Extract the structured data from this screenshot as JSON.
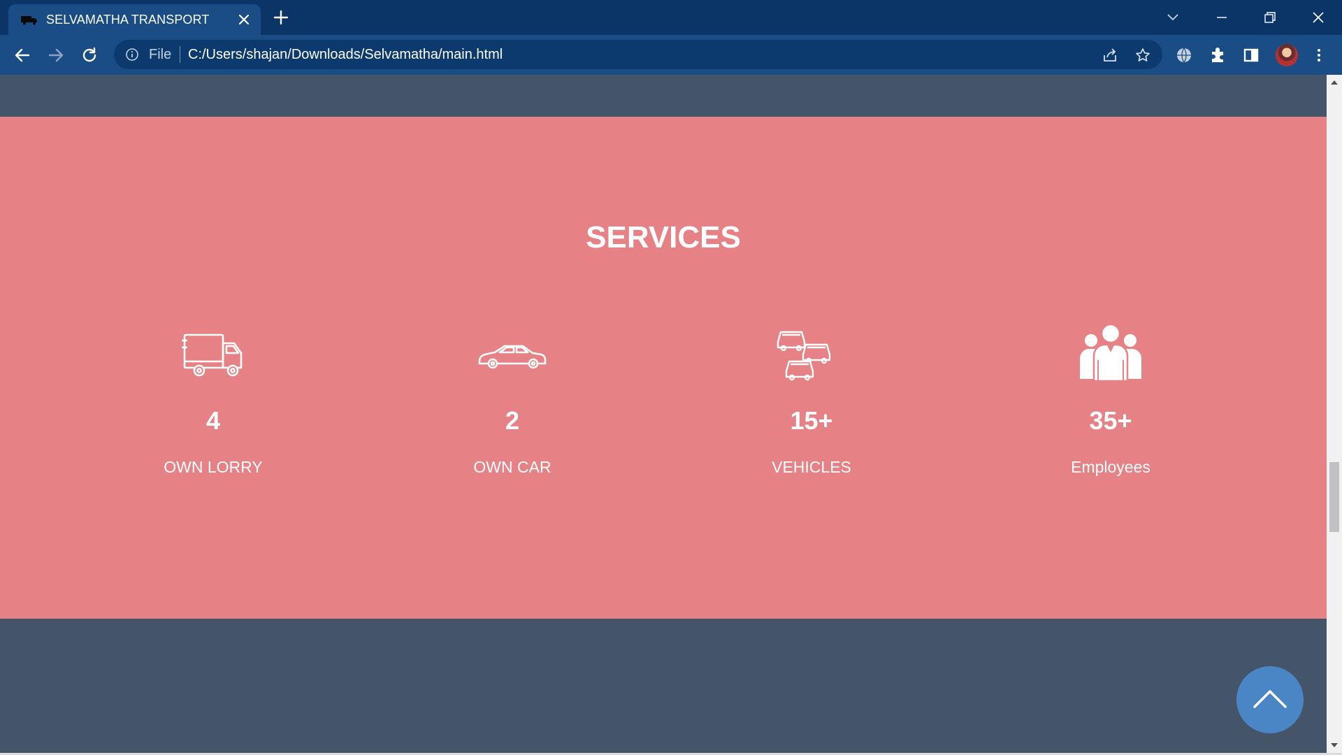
{
  "browser": {
    "tab_title": "SELVAMATHA TRANSPORT",
    "file_label": "File",
    "url": "C:/Users/shajan/Downloads/Selvamatha/main.html"
  },
  "page": {
    "services_title": "SERVICES",
    "section_color": "#e68286",
    "background_color": "#44556a",
    "stats": [
      {
        "icon": "truck-icon",
        "number": "4",
        "label": "OWN LORRY"
      },
      {
        "icon": "car-icon",
        "number": "2",
        "label": "OWN CAR"
      },
      {
        "icon": "vehicles-icon",
        "number": "15+",
        "label": "VEHICLES"
      },
      {
        "icon": "employees-icon",
        "number": "35+",
        "label": "Employees"
      }
    ],
    "scroll_top_icon": "chevron-up-icon"
  }
}
